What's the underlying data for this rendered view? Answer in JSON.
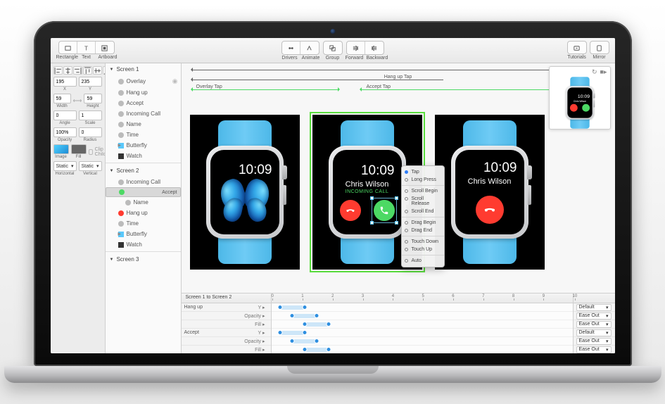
{
  "toolbar": {
    "left": [
      {
        "name": "rectangle-tool",
        "label": "Rectangle",
        "icon": "rect"
      },
      {
        "name": "text-tool",
        "label": "Text",
        "icon": "text"
      },
      {
        "name": "artboard-tool",
        "label": "Artboard",
        "icon": "artboard"
      }
    ],
    "center": [
      {
        "name": "drivers-tool",
        "label": "Drivers",
        "icon": "drivers"
      },
      {
        "name": "animate-tool",
        "label": "Animate",
        "icon": "animate"
      },
      {
        "name": "group-tool",
        "label": "Group",
        "icon": "group"
      },
      {
        "name": "forward-tool",
        "label": "Forward",
        "icon": "forward"
      },
      {
        "name": "backward-tool",
        "label": "Backward",
        "icon": "backward"
      }
    ],
    "right": [
      {
        "name": "tutorials-tool",
        "label": "Tutorials",
        "icon": "tutorials"
      },
      {
        "name": "mirror-tool",
        "label": "Mirror",
        "icon": "mirror"
      }
    ]
  },
  "inspector": {
    "x": "195",
    "y": "235",
    "width": "59",
    "height": "59",
    "angle": "0",
    "scale": "1",
    "opacity": "100%",
    "radius": "0",
    "imageLabel": "Image",
    "fillLabel": "Fill",
    "clipChildren": "Clip Children",
    "staticLabel": "Static",
    "horizontalLabel": "Horizontal",
    "verticalLabel": "Vertical",
    "xLabel": "X",
    "yLabel": "Y",
    "widthLabel": "Width",
    "heightLabel": "Height",
    "angleLabel": "Angle",
    "scaleLabel": "Scale",
    "opacityLabel": "Opacity",
    "radiusLabel": "Radius"
  },
  "layers": {
    "screen1": "Screen 1",
    "screen2": "Screen 2",
    "screen3": "Screen 3",
    "items1": [
      {
        "type": "gray",
        "label": "Overlay",
        "eye": true
      },
      {
        "type": "gray",
        "label": "Hang up"
      },
      {
        "type": "gray",
        "label": "Accept"
      },
      {
        "type": "gray",
        "label": "Incoming Call"
      },
      {
        "type": "gray",
        "label": "Name"
      },
      {
        "type": "gray",
        "label": "Time"
      },
      {
        "type": "blue",
        "label": "Butterfly",
        "expandable": true
      },
      {
        "type": "dark",
        "label": "Watch"
      }
    ],
    "items2": [
      {
        "type": "gray",
        "label": "Incoming Call"
      },
      {
        "type": "green",
        "label": "Accept",
        "selected": true
      },
      {
        "type": "gray",
        "label": "Name",
        "indent": true
      },
      {
        "type": "red",
        "label": "Hang up"
      },
      {
        "type": "gray",
        "label": "Time"
      },
      {
        "type": "blue",
        "label": "Butterfly",
        "expandable": true
      },
      {
        "type": "dark",
        "label": "Watch"
      }
    ]
  },
  "transitions": {
    "hangupTap": "Hang up Tap",
    "acceptTap": "Accept Tap",
    "overlayTap": "Overlay Tap"
  },
  "contextMenu": [
    {
      "label": "Tap",
      "checked": true
    },
    {
      "label": "Long Press",
      "ring": true
    },
    "div",
    {
      "label": "Scroll Begin",
      "ring": true
    },
    {
      "label": "Scroll Release",
      "ring": true
    },
    {
      "label": "Scroll End",
      "ring": true
    },
    "div",
    {
      "label": "Drag Begin",
      "ring": true
    },
    {
      "label": "Drag End",
      "ring": true
    },
    "div",
    {
      "label": "Touch Down",
      "ring": true
    },
    {
      "label": "Touch Up",
      "ring": true
    },
    "div",
    {
      "label": "Auto",
      "ring": true
    }
  ],
  "artboards": {
    "time": "10:09",
    "caller": "Chris Wilson",
    "incoming": "INCOMING CALL"
  },
  "timeline": {
    "title": "Screen 1 to Screen 2",
    "ticks": [
      "0",
      "1",
      "2",
      "3",
      "4",
      "5",
      "6",
      "7",
      "8",
      "9",
      "10"
    ],
    "groups": [
      {
        "name": "Hang up",
        "rows": [
          {
            "prop": "Y",
            "ease": "Default",
            "start": 3,
            "end": 11
          },
          {
            "prop": "Opacity",
            "ease": "Ease Out",
            "start": 7,
            "end": 15
          },
          {
            "prop": "Fill",
            "ease": "Ease Out",
            "start": 11,
            "end": 19
          }
        ]
      },
      {
        "name": "Accept",
        "rows": [
          {
            "prop": "Y",
            "ease": "Default",
            "start": 3,
            "end": 11
          },
          {
            "prop": "Opacity",
            "ease": "Ease Out",
            "start": 7,
            "end": 15
          },
          {
            "prop": "Fill",
            "ease": "Ease Out",
            "start": 11,
            "end": 19
          }
        ]
      }
    ],
    "easeDropdownCaret": "▾"
  }
}
